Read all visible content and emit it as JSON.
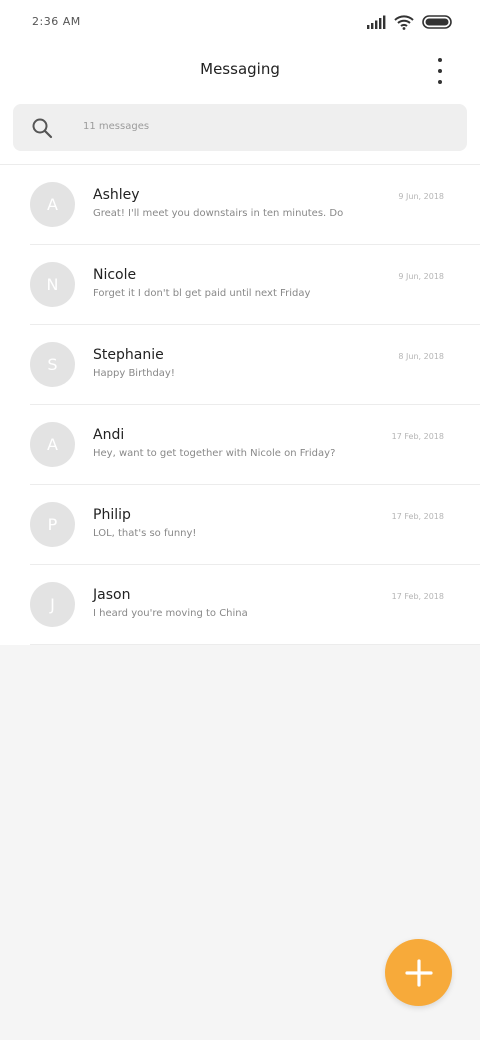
{
  "status_bar": {
    "time": "2:36 AM"
  },
  "header": {
    "title": "Messaging",
    "menu_icon": "more-vertical-icon"
  },
  "search": {
    "icon": "search-icon",
    "placeholder": "11 messages"
  },
  "conversations": [
    {
      "initial": "A",
      "name": "Ashley",
      "snippet": "Great! I'll meet you downstairs in ten minutes. Don't forge",
      "date": "9 Jun, 2018"
    },
    {
      "initial": "N",
      "name": "Nicole",
      "snippet": "Forget it I don't bl get paid until next Friday",
      "date": "9 Jun, 2018"
    },
    {
      "initial": "S",
      "name": "Stephanie",
      "snippet": "Happy Birthday!",
      "date": "8 Jun, 2018"
    },
    {
      "initial": "A",
      "name": "Andi",
      "snippet": "Hey, want to get together with Nicole on Friday?",
      "date": "17 Feb, 2018"
    },
    {
      "initial": "P",
      "name": "Philip",
      "snippet": "LOL, that's so funny!",
      "date": "17 Feb, 2018"
    },
    {
      "initial": "J",
      "name": "Jason",
      "snippet": "I heard you're moving to China",
      "date": "17 Feb, 2018"
    }
  ],
  "fab": {
    "icon": "plus-icon"
  },
  "colors": {
    "accent": "#f7aa3a",
    "avatar_bg": "#e3e3e3",
    "background": "#f5f5f5"
  }
}
